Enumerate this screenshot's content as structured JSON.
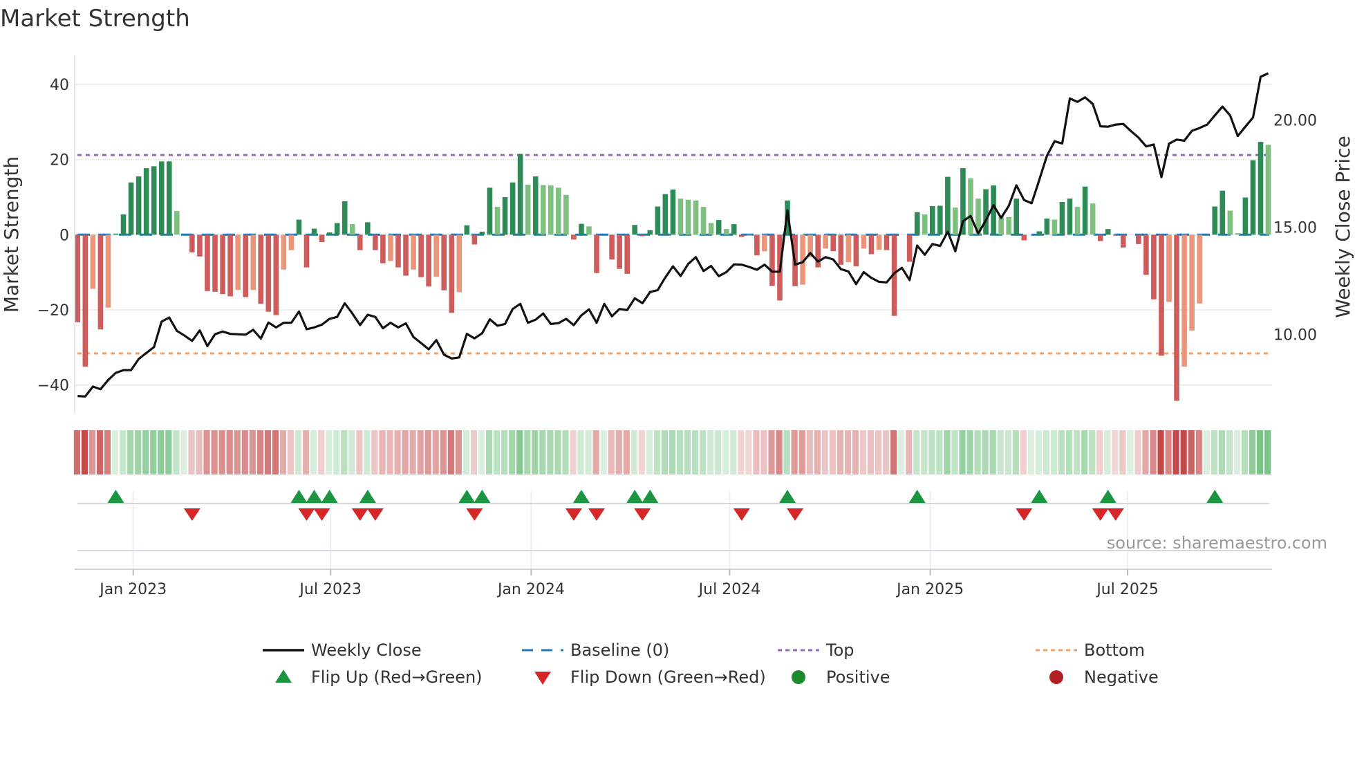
{
  "chart_data": {
    "type": "bar",
    "title": "Market Strength",
    "ylabel": "Market Strength",
    "y2label": "Weekly Close Price",
    "ylim": [
      -48,
      48
    ],
    "y2lim": [
      6.4,
      24.4
    ],
    "yticks": [
      40,
      20,
      0,
      -20,
      -40
    ],
    "y2ticks": [
      "20.00",
      "15.00",
      "10.00"
    ],
    "x_ticks": [
      {
        "label": "Jan 2023",
        "date": "2023-01-01"
      },
      {
        "label": "Jul 2023",
        "date": "2023-07-01"
      },
      {
        "label": "Jan 2024",
        "date": "2024-01-01"
      },
      {
        "label": "Jul 2024",
        "date": "2024-07-01"
      },
      {
        "label": "Jan 2025",
        "date": "2025-01-01"
      },
      {
        "label": "Jul 2025",
        "date": "2025-07-01"
      }
    ],
    "x": [
      "2022-11-11",
      "2022-11-18",
      "2022-11-25",
      "2022-12-02",
      "2022-12-09",
      "2022-12-16",
      "2022-12-23",
      "2022-12-30",
      "2023-01-06",
      "2023-01-13",
      "2023-01-20",
      "2023-01-27",
      "2023-02-03",
      "2023-02-10",
      "2023-02-17",
      "2023-02-24",
      "2023-03-03",
      "2023-03-10",
      "2023-03-17",
      "2023-03-24",
      "2023-03-31",
      "2023-04-07",
      "2023-04-14",
      "2023-04-21",
      "2023-04-28",
      "2023-05-05",
      "2023-05-12",
      "2023-05-19",
      "2023-05-26",
      "2023-06-02",
      "2023-06-09",
      "2023-06-16",
      "2023-06-23",
      "2023-06-30",
      "2023-07-07",
      "2023-07-14",
      "2023-07-21",
      "2023-07-28",
      "2023-08-04",
      "2023-08-11",
      "2023-08-18",
      "2023-08-25",
      "2023-09-01",
      "2023-09-08",
      "2023-09-15",
      "2023-09-22",
      "2023-09-29",
      "2023-10-06",
      "2023-10-13",
      "2023-10-20",
      "2023-10-27",
      "2023-11-03",
      "2023-11-10",
      "2023-11-17",
      "2023-11-24",
      "2023-12-01",
      "2023-12-08",
      "2023-12-15",
      "2023-12-22",
      "2023-12-29",
      "2024-01-05",
      "2024-01-12",
      "2024-01-19",
      "2024-01-26",
      "2024-02-02",
      "2024-02-09",
      "2024-02-16",
      "2024-02-23",
      "2024-03-01",
      "2024-03-08",
      "2024-03-15",
      "2024-03-22",
      "2024-03-29",
      "2024-04-05",
      "2024-04-12",
      "2024-04-19",
      "2024-04-26",
      "2024-05-03",
      "2024-05-10",
      "2024-05-17",
      "2024-05-24",
      "2024-05-31",
      "2024-06-07",
      "2024-06-14",
      "2024-06-21",
      "2024-06-28",
      "2024-07-05",
      "2024-07-12",
      "2024-07-19",
      "2024-07-26",
      "2024-08-02",
      "2024-08-09",
      "2024-08-16",
      "2024-08-23",
      "2024-08-30",
      "2024-09-06",
      "2024-09-13",
      "2024-09-20",
      "2024-09-27",
      "2024-10-04",
      "2024-10-11",
      "2024-10-18",
      "2024-10-25",
      "2024-11-01",
      "2024-11-08",
      "2024-11-15",
      "2024-11-22",
      "2024-11-29",
      "2024-12-06",
      "2024-12-13",
      "2024-12-20",
      "2024-12-27",
      "2025-01-03",
      "2025-01-10",
      "2025-01-17",
      "2025-01-24",
      "2025-01-31",
      "2025-02-07",
      "2025-02-14",
      "2025-02-21",
      "2025-02-28",
      "2025-03-07",
      "2025-03-14",
      "2025-03-21",
      "2025-03-28",
      "2025-04-04",
      "2025-04-11",
      "2025-04-18",
      "2025-04-25",
      "2025-05-02",
      "2025-05-09",
      "2025-05-16",
      "2025-05-23",
      "2025-05-30",
      "2025-06-06",
      "2025-06-13",
      "2025-06-20",
      "2025-06-27",
      "2025-07-04",
      "2025-07-11",
      "2025-07-18",
      "2025-07-25",
      "2025-08-01",
      "2025-08-08",
      "2025-08-15",
      "2025-08-22",
      "2025-08-29",
      "2025-09-05",
      "2025-09-12",
      "2025-09-19",
      "2025-09-26",
      "2025-10-03",
      "2025-10-10",
      "2025-10-17",
      "2025-10-24",
      "2025-10-31",
      "2025-11-07"
    ],
    "strength": [
      -23.3,
      -35.1,
      -14.4,
      -25.2,
      -19.4,
      0.3,
      5.4,
      13.9,
      15.5,
      17.7,
      18.2,
      19.5,
      19.5,
      6.3,
      0,
      -4.7,
      -5.8,
      -15.0,
      -15.2,
      -15.8,
      -16.4,
      -14.7,
      -16.6,
      -14.7,
      -18.4,
      -20.5,
      -21.4,
      -9.3,
      -4.1,
      4.0,
      -8.7,
      1.6,
      -2.0,
      0.6,
      3.1,
      8.9,
      2.8,
      -4.1,
      3.3,
      -4.1,
      -7.6,
      -7.0,
      -8.7,
      -10.9,
      -9.3,
      -11.3,
      -13.8,
      -11.2,
      -14.8,
      -20.8,
      -15.3,
      2.5,
      -2.6,
      0.8,
      12.5,
      7.4,
      10.0,
      13.9,
      21.5,
      13.3,
      15.5,
      13.2,
      13.1,
      12.5,
      10.6,
      -1.3,
      2.9,
      2.2,
      -10.2,
      0,
      -6.6,
      -9.1,
      -10.4,
      2.6,
      -0.4,
      1.2,
      7.5,
      10.8,
      12.0,
      9.6,
      9.3,
      9.1,
      7.4,
      3.1,
      3.9,
      1.5,
      2.8,
      -0.6,
      -0.1,
      -5.5,
      -4.4,
      -13.6,
      -17.5,
      9.1,
      -13.7,
      -13.3,
      -6.0,
      -8.7,
      -3.7,
      -4.4,
      -8.0,
      -7.3,
      -8.4,
      -3.7,
      -5.2,
      -4.0,
      -4.1,
      -21.6,
      0,
      -7.2,
      6.0,
      5.4,
      7.6,
      7.7,
      15.4,
      7.2,
      17.7,
      15.0,
      9.6,
      12.1,
      13.1,
      4.8,
      4.7,
      9.6,
      -1.5,
      0,
      0.9,
      4.3,
      4.0,
      8.7,
      9.6,
      7.4,
      12.8,
      8.3,
      -1.7,
      1.5,
      -0.2,
      -3.4,
      0,
      -2.5,
      -10.7,
      -17.2,
      -32.2,
      -17.9,
      -44.2,
      -35.1,
      -25.5,
      -18.3,
      0,
      7.5,
      11.7,
      6.4,
      0.4,
      9.9,
      19.8,
      24.7,
      23.9
    ],
    "weekly_close": [
      7.12,
      7.1,
      7.56,
      7.44,
      7.87,
      8.2,
      8.33,
      8.33,
      8.85,
      9.13,
      9.4,
      10.59,
      10.78,
      10.16,
      9.94,
      9.69,
      10.18,
      9.45,
      10.0,
      10.13,
      10.02,
      10.0,
      9.98,
      10.21,
      9.8,
      10.55,
      10.32,
      10.54,
      10.54,
      11.06,
      10.24,
      10.32,
      10.45,
      10.72,
      10.81,
      11.45,
      10.97,
      10.43,
      10.91,
      10.81,
      10.28,
      10.54,
      10.32,
      10.51,
      9.87,
      9.59,
      9.3,
      9.73,
      9.05,
      8.87,
      8.92,
      10.02,
      9.81,
      10.05,
      10.7,
      10.4,
      10.48,
      11.18,
      11.42,
      10.54,
      10.68,
      10.97,
      10.48,
      10.52,
      10.72,
      10.43,
      10.88,
      11.16,
      10.54,
      11.42,
      10.84,
      11.18,
      11.13,
      11.68,
      11.45,
      11.97,
      12.06,
      12.65,
      13.17,
      12.72,
      13.28,
      13.6,
      12.95,
      13.19,
      12.71,
      12.9,
      13.26,
      13.25,
      13.14,
      13.01,
      13.25,
      12.92,
      12.92,
      15.78,
      13.25,
      13.36,
      13.79,
      13.39,
      13.6,
      13.49,
      13.04,
      12.93,
      12.34,
      12.9,
      12.63,
      12.45,
      12.42,
      12.85,
      13.1,
      12.53,
      14.14,
      13.71,
      14.21,
      14.12,
      14.78,
      13.87,
      15.27,
      15.52,
      14.7,
      15.32,
      16.02,
      15.43,
      15.99,
      16.95,
      16.26,
      16.11,
      17.2,
      18.33,
      19.0,
      18.9,
      21.0,
      20.84,
      21.05,
      20.75,
      19.7,
      19.68,
      19.78,
      19.81,
      19.48,
      19.17,
      18.76,
      18.85,
      17.33,
      18.89,
      19.08,
      19.03,
      19.49,
      19.62,
      19.78,
      20.21,
      20.62,
      20.21,
      19.25,
      19.68,
      20.11,
      22.01,
      22.17
    ],
    "baseline": 0,
    "top": 21.2,
    "bottom": -31.6,
    "grid": true,
    "legend_placement": "bottom",
    "source": "source: sharemaestro.com",
    "legend": [
      {
        "label": "Weekly Close",
        "kind": "line",
        "color": "#111111"
      },
      {
        "label": "Baseline (0)",
        "kind": "dash",
        "color": "#1f77b4"
      },
      {
        "label": "Top",
        "kind": "dot",
        "color": "#9467bd"
      },
      {
        "label": "Bottom",
        "kind": "dot",
        "color": "#f4a261"
      },
      {
        "label": "Flip Up (Red→Green)",
        "kind": "tri-up",
        "color": "#1a9641"
      },
      {
        "label": "Flip Down (Green→Red)",
        "kind": "tri-down",
        "color": "#d62728"
      },
      {
        "label": "Positive",
        "kind": "circle",
        "color": "#1e8a2e"
      },
      {
        "label": "Negative",
        "kind": "circle",
        "color": "#b22222"
      }
    ],
    "colors": {
      "pos_rising": "#2e8b57",
      "pos_falling": "#7fbf7f",
      "neg_falling": "#cd5c5c",
      "neg_rising": "#e9967a",
      "baseline": "#1f77b4",
      "top": "#9467bd",
      "bottom": "#f4a261",
      "line": "#111111",
      "flip_up": "#1a9641",
      "flip_down": "#d62728"
    }
  }
}
